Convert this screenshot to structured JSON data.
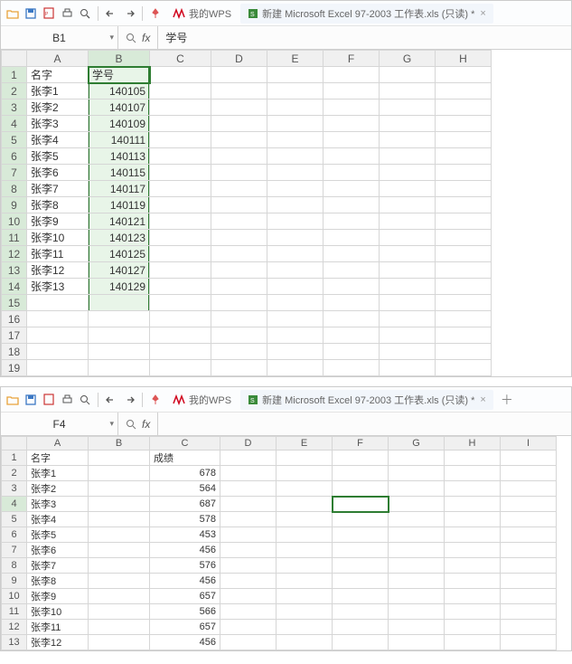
{
  "panel1": {
    "toolbar": {
      "icons": [
        "folder-open",
        "save",
        "pdf",
        "print",
        "preview",
        "undo",
        "redo"
      ],
      "pin_color": "#d55",
      "wps_logo_color": "#d0021b",
      "wps_label": "我的WPS",
      "doc_tab": "新建 Microsoft Excel 97-2003 工作表.xls (只读) *"
    },
    "namebox": "B1",
    "fx": "fx",
    "formula_value": "学号",
    "columns": [
      "A",
      "B",
      "C",
      "D",
      "E",
      "F",
      "G",
      "H"
    ],
    "selected_col": "B",
    "selected_cell": "B1",
    "highlight_range": {
      "col": "B",
      "r1": 1,
      "r2": 15
    },
    "row_count": 19,
    "filled_rows": 14,
    "data": {
      "header": {
        "A": "名字",
        "B": "学号"
      },
      "rows": [
        {
          "A": "张李1",
          "B": "140105"
        },
        {
          "A": "张李2",
          "B": "140107"
        },
        {
          "A": "张李3",
          "B": "140109"
        },
        {
          "A": "张李4",
          "B": "140111"
        },
        {
          "A": "张李5",
          "B": "140113"
        },
        {
          "A": "张李6",
          "B": "140115"
        },
        {
          "A": "张李7",
          "B": "140117"
        },
        {
          "A": "张李8",
          "B": "140119"
        },
        {
          "A": "张李9",
          "B": "140121"
        },
        {
          "A": "张李10",
          "B": "140123"
        },
        {
          "A": "张李11",
          "B": "140125"
        },
        {
          "A": "张李12",
          "B": "140127"
        },
        {
          "A": "张李13",
          "B": "140129"
        }
      ]
    }
  },
  "panel2": {
    "toolbar": {
      "icons": [
        "folder-open",
        "save",
        "pdf",
        "print",
        "preview",
        "undo",
        "redo"
      ],
      "pin_color": "#d55",
      "wps_logo_color": "#d0021b",
      "wps_label": "我的WPS",
      "doc_tab": "新建 Microsoft Excel 97-2003 工作表.xls (只读) *",
      "has_plus": true
    },
    "namebox": "F4",
    "fx": "fx",
    "formula_value": "",
    "columns": [
      "A",
      "B",
      "C",
      "D",
      "E",
      "F",
      "G",
      "H",
      "I"
    ],
    "selected_cell": "F4",
    "row_count": 13,
    "data": {
      "header": {
        "A": "名字",
        "C": "成绩"
      },
      "rows": [
        {
          "A": "张李1",
          "C": "678"
        },
        {
          "A": "张李2",
          "C": "564"
        },
        {
          "A": "张李3",
          "C": "687"
        },
        {
          "A": "张李4",
          "C": "578"
        },
        {
          "A": "张李5",
          "C": "453"
        },
        {
          "A": "张李6",
          "C": "456"
        },
        {
          "A": "张李7",
          "C": "576"
        },
        {
          "A": "张李8",
          "C": "456"
        },
        {
          "A": "张李9",
          "C": "657"
        },
        {
          "A": "张李10",
          "C": "566"
        },
        {
          "A": "张李11",
          "C": "657"
        },
        {
          "A": "张李12",
          "C": "456"
        }
      ]
    }
  }
}
